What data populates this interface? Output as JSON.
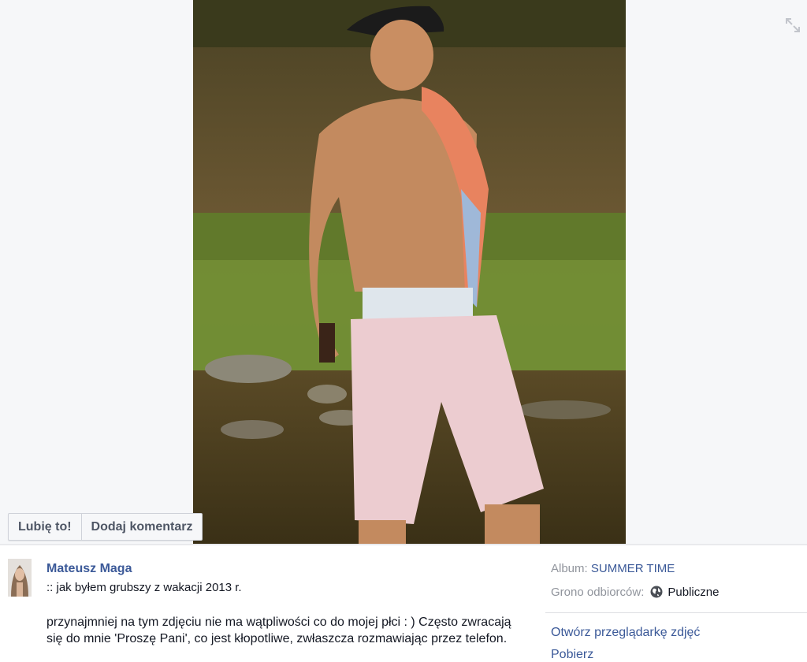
{
  "actions": {
    "like_label": "Lubię to!",
    "comment_label": "Dodaj komentarz"
  },
  "photo": {
    "expand_icon": "expand-icon"
  },
  "post": {
    "author": "Mateusz Maga",
    "caption_line": ":: jak byłem grubszy z wakacji 2013 r.",
    "caption_body": "przynajmniej na tym zdjęciu nie ma wątpliwości co do mojej płci : ) Często zwracają się do mnie 'Proszę Pani', co jest kłopotliwe, zwłaszcza rozmawiając przez telefon."
  },
  "meta": {
    "album_label": "Album:",
    "album_value": "SUMMER TIME",
    "audience_label": "Grono odbiorców:",
    "audience_icon": "globe-icon",
    "audience_value": "Publiczne"
  },
  "links": {
    "open_viewer": "Otwórz przeglądarkę zdjęć",
    "download": "Pobierz"
  },
  "colors": {
    "link": "#3b5998",
    "stage_bg": "#f6f7f9"
  }
}
